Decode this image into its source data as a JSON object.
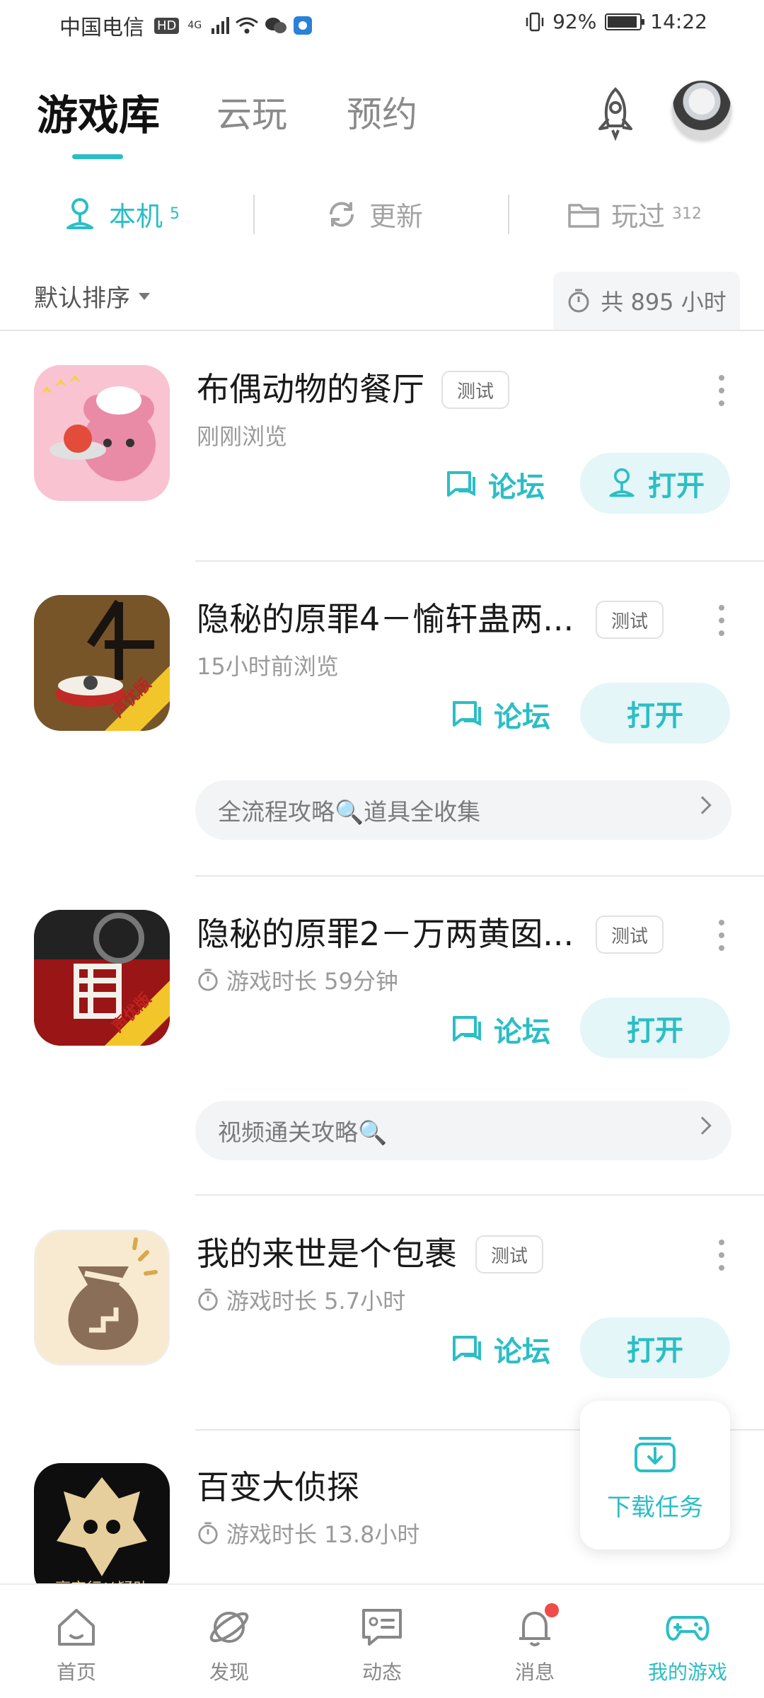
{
  "status_bar": {
    "carrier": "中国电信",
    "hd_badge": "HD",
    "network": "4G",
    "battery": "92%",
    "battery_level": 0.92,
    "time": "14:22"
  },
  "header": {
    "tabs": [
      {
        "label": "游戏库",
        "active": true
      },
      {
        "label": "云玩",
        "active": false
      },
      {
        "label": "预约",
        "active": false
      }
    ],
    "rocket_icon": "rocket-icon",
    "avatar": "user-avatar"
  },
  "sub_tabs": [
    {
      "label": "本机",
      "count": "5",
      "icon": "phone-user-icon",
      "active": true
    },
    {
      "label": "更新",
      "count": "",
      "icon": "refresh-icon",
      "active": false
    },
    {
      "label": "玩过",
      "count": "312",
      "icon": "folder-icon",
      "active": false
    }
  ],
  "sort": {
    "label": "默认排序",
    "total_time": "共 895 小时"
  },
  "games": [
    {
      "name": "布偶动物的餐厅",
      "tag": "测试",
      "subtitle": "刚刚浏览",
      "forum_label": "论坛",
      "open_label": "打开",
      "guide": ""
    },
    {
      "name": "隐秘的原罪4－愉轩蛊两...",
      "tag": "测试",
      "subtitle": "15小时前浏览",
      "forum_label": "论坛",
      "open_label": "打开",
      "guide": "全流程攻略🔍道具全收集",
      "icon_badge": "声优版"
    },
    {
      "name": "隐秘的原罪2－万两黄囡...",
      "tag": "测试",
      "subtitle": "游戏时长 59分钟",
      "forum_label": "论坛",
      "open_label": "打开",
      "guide": "视频通关攻略🔍",
      "icon_badge": "声优版"
    },
    {
      "name": "我的来世是个包裹",
      "tag": "测试",
      "subtitle": "游戏时长 5.7小时",
      "forum_label": "论坛",
      "open_label": "打开",
      "guide": ""
    },
    {
      "name": "百变大侦探",
      "tag": "",
      "subtitle": "游戏时长 13.8小时",
      "forum_label": "",
      "open_label": "",
      "guide": "",
      "icon_badge": "豪宅行凶疑助"
    }
  ],
  "download_task": {
    "label": "下载任务"
  },
  "bottom_nav": [
    {
      "label": "首页",
      "icon": "home-icon"
    },
    {
      "label": "发现",
      "icon": "planet-icon"
    },
    {
      "label": "动态",
      "icon": "chat-card-icon"
    },
    {
      "label": "消息",
      "icon": "bell-icon"
    },
    {
      "label": "我的游戏",
      "icon": "gamepad-icon",
      "active": true
    }
  ],
  "colors": {
    "accent": "#2bbec5",
    "accent_light": "#e4f6f7",
    "notification": "#f04b4b"
  }
}
